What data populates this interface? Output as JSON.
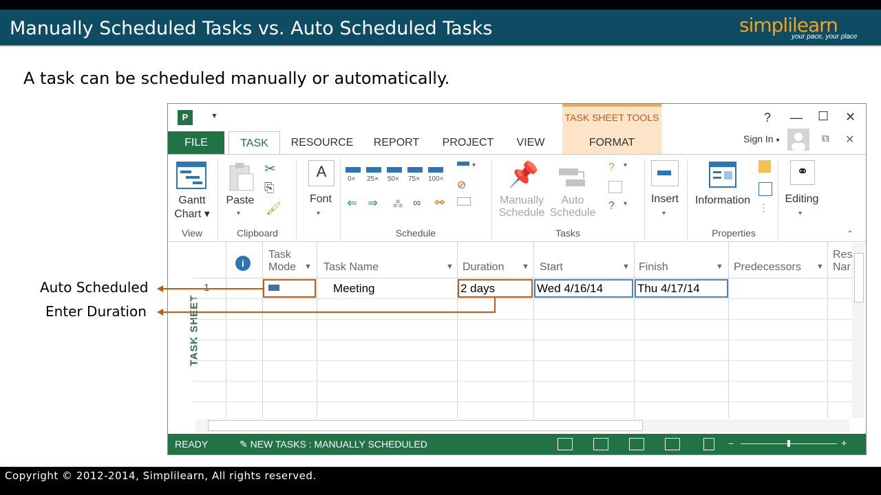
{
  "slide": {
    "title": "Manually Scheduled Tasks vs. Auto Scheduled Tasks",
    "logo_text": "simplilearn",
    "logo_tagline": "your pace, your place",
    "intro": "A task can be scheduled manually or automatically.",
    "copyright": "Copyright © 2012-2014, Simplilearn, All rights reserved.",
    "callouts": [
      "Auto Scheduled",
      "Enter Duration"
    ]
  },
  "app": {
    "icon_letter": "P",
    "qat_dropdown": "▼",
    "contextual_group": "TASK SHEET TOOLS",
    "window_buttons": {
      "help": "?",
      "minimize": "—",
      "maximize": "☐",
      "close": "✕",
      "restore": "⧉",
      "close2": "✕"
    },
    "sign_in": "Sign In",
    "tabs": [
      "FILE",
      "TASK",
      "RESOURCE",
      "REPORT",
      "PROJECT",
      "VIEW",
      "FORMAT"
    ],
    "ribbon": {
      "groups": [
        "View",
        "Clipboard",
        "Schedule",
        "Tasks",
        "Properties"
      ],
      "buttons": {
        "gantt_chart": [
          "Gantt",
          "Chart ▾"
        ],
        "paste": "Paste",
        "font": "Font",
        "manually_schedule": [
          "Manually",
          "Schedule"
        ],
        "auto_schedule": [
          "Auto",
          "Schedule"
        ],
        "insert": "Insert",
        "information": "Information",
        "editing": "Editing"
      },
      "percent_buttons": [
        "0×",
        "25×",
        "50×",
        "75×",
        "100×"
      ]
    },
    "sheet": {
      "sidebar_label": "TASK SHEET",
      "headers": {
        "info": "i",
        "task_mode": [
          "Task",
          "Mode"
        ],
        "task_name": "Task Name",
        "duration": "Duration",
        "start": "Start",
        "finish": "Finish",
        "predecessors": "Predecessors",
        "resource": [
          "Res",
          "Nar"
        ]
      },
      "rows": [
        {
          "id": "1",
          "task_name": "Meeting",
          "duration": "2 days",
          "start": "Wed 4/16/14",
          "finish": "Thu 4/17/14"
        }
      ]
    },
    "status": {
      "ready": "READY",
      "new_tasks": "NEW TASKS : MANUALLY SCHEDULED"
    }
  },
  "colors": {
    "title_bar": "#0d4c63",
    "accent_green": "#217346",
    "callout_orange": "#c55a11",
    "logo_orange": "#f6a11a"
  }
}
